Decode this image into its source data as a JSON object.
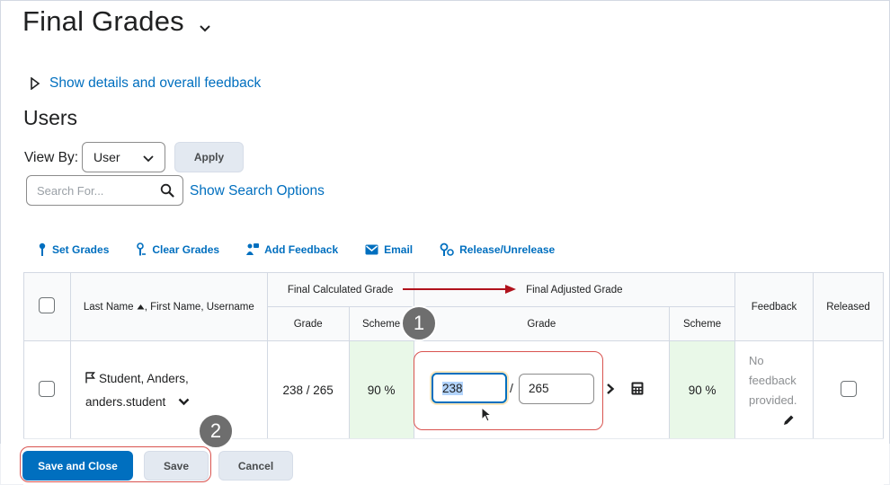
{
  "page": {
    "title": "Final Grades",
    "details_link": "Show details and overall feedback",
    "section_title": "Users"
  },
  "filters": {
    "view_by_label": "View By:",
    "view_by_value": "User",
    "apply_label": "Apply",
    "search_placeholder": "Search For...",
    "search_options_link": "Show Search Options"
  },
  "actions": [
    {
      "label": "Set Grades",
      "icon": "pin-icon"
    },
    {
      "label": "Clear Grades",
      "icon": "clear-pin-icon"
    },
    {
      "label": "Add Feedback",
      "icon": "feedback-icon"
    },
    {
      "label": "Email",
      "icon": "email-icon"
    },
    {
      "label": "Release/Unrelease",
      "icon": "release-icon"
    }
  ],
  "table": {
    "col_name": "Last Name",
    "col_name_rest": ", First Name, Username",
    "col_final_calculated": "Final Calculated Grade",
    "col_final_adjusted": "Final Adjusted Grade",
    "col_grade": "Grade",
    "col_scheme": "Scheme",
    "col_feedback": "Feedback",
    "col_released": "Released",
    "rows": [
      {
        "name_line1": "Student, Anders,",
        "name_line2": "anders.student",
        "calc_grade": "238 / 265",
        "calc_scheme": "90 %",
        "adj_numerator": "238",
        "adj_slash": "/",
        "adj_denominator": "265",
        "adj_scheme": "90 %",
        "feedback_line1": "No",
        "feedback_line2": "feedback",
        "feedback_line3": "provided."
      }
    ]
  },
  "buttons": {
    "save_and_close": "Save and Close",
    "save": "Save",
    "cancel": "Cancel"
  },
  "annotations": {
    "badge1": "1",
    "badge2": "2"
  },
  "colors": {
    "link": "#006fbf",
    "primary": "#006fbf",
    "annotation": "#d9534f",
    "arrow": "#b0121c",
    "scheme_bg": "#e9f8e8"
  }
}
